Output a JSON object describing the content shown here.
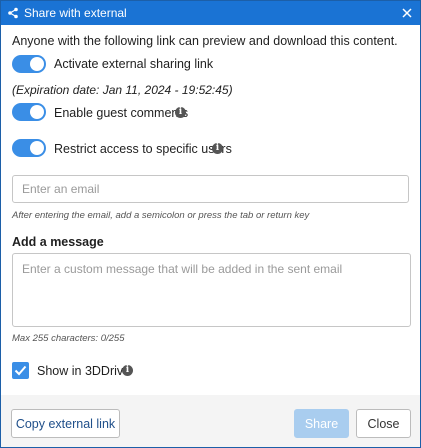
{
  "window": {
    "title": "Share with external",
    "app_icon": "share-icon",
    "close_icon": "close-icon"
  },
  "intro_text": "Anyone with the following link can preview and download this content.",
  "toggles": [
    {
      "label": "Activate external sharing link",
      "on": true
    },
    {
      "label": "Enable guest comments",
      "on": true,
      "info": true
    },
    {
      "label": "Restrict access to specific users",
      "on": true,
      "info": true
    }
  ],
  "expiration_text": "(Expiration date: Jan 11, 2024 - 19:52:45)",
  "email": {
    "value": "",
    "placeholder": "Enter an email",
    "hint": "After entering the email, add a semicolon or press the tab or return key"
  },
  "message": {
    "label": "Add a message",
    "value": "",
    "placeholder": "Enter a custom message that will be added in the sent email",
    "counter": "Max 255 characters: 0/255"
  },
  "show_in_3ddrive": {
    "label": "Show in 3DDrive",
    "checked": true
  },
  "buttons": {
    "copy_link": "Copy external link",
    "share": "Share",
    "close": "Close"
  },
  "colors": {
    "titlebar": "#1a73d4",
    "accent": "#3a8ee6",
    "share_disabled": "#a9cdef",
    "footer": "#f4f4f4"
  }
}
